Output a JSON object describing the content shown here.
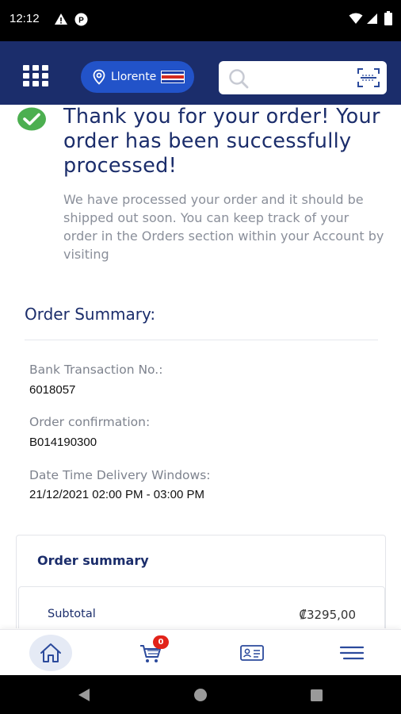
{
  "status_bar": {
    "time": "12:12"
  },
  "header": {
    "location_label": "Llorente",
    "search": {
      "placeholder": "",
      "value": ""
    }
  },
  "confirmation": {
    "title": "Thank you for your order! Your order has been successfully processed!",
    "description": "We have processed your order and it should be shipped out soon. You can keep track of your order in the Orders section within your Account by visiting"
  },
  "order_summary": {
    "heading": "Order Summary:",
    "fields": [
      {
        "label": "Bank Transaction No.:",
        "value": "6018057"
      },
      {
        "label": "Order confirmation:",
        "value": "B014190300"
      },
      {
        "label": "Date Time Delivery Windows:",
        "value": "21/12/2021 02:00 PM - 03:00 PM"
      }
    ]
  },
  "summary_card": {
    "title": "Order summary",
    "subtotal_label": "Subtotal",
    "subtotal_value": "₡3295,00"
  },
  "bottom_nav": {
    "cart_count": "0",
    "items": [
      "home-icon",
      "cart-icon",
      "id-card-icon",
      "menu-icon"
    ]
  },
  "colors": {
    "header_bg": "#1b2d6b",
    "location_pill": "#2253c9",
    "success_green": "#4caf50",
    "badge_red": "#e2231a",
    "title_navy": "#1b2d6b"
  }
}
